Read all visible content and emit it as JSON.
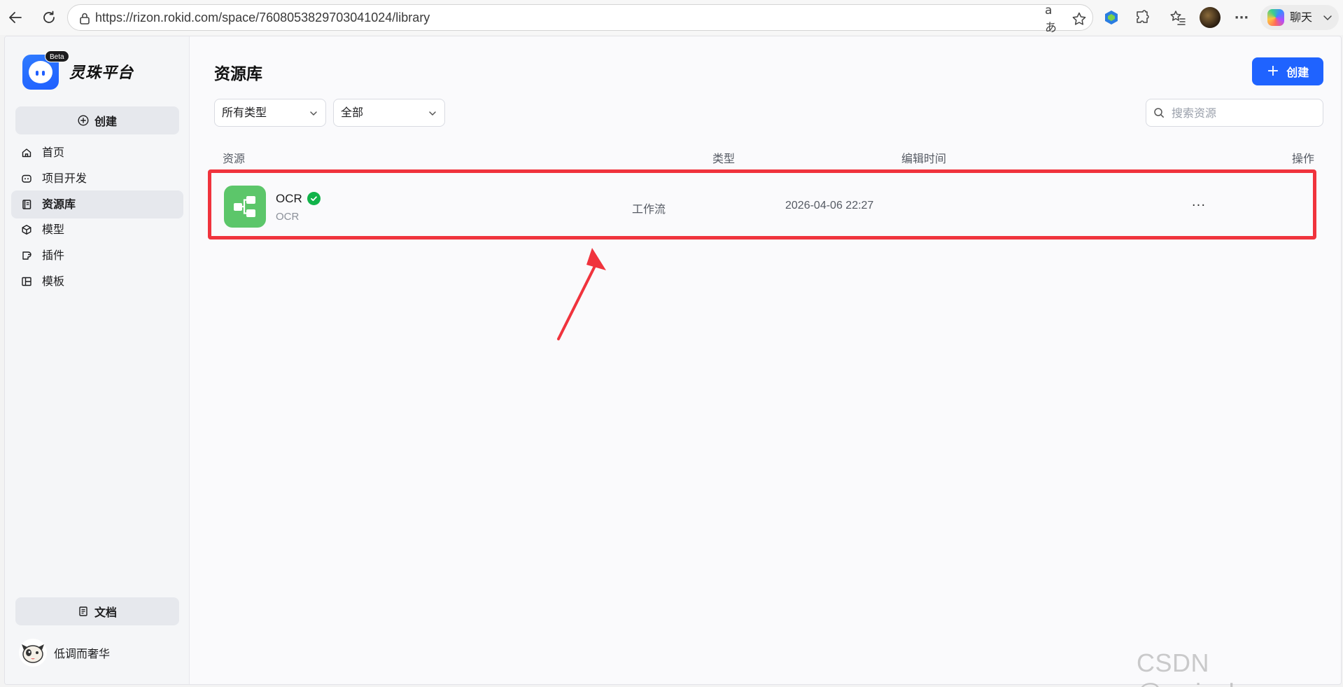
{
  "browser": {
    "url": "https://rizon.rokid.com/space/7608053829703041024/library",
    "read_aloud_icon": "aあ",
    "chat_label": "聊天"
  },
  "brand": {
    "name": "灵珠平台",
    "badge": "Beta",
    "accent": "#1f63ff"
  },
  "sidebar": {
    "create_label": "创建",
    "items": [
      {
        "label": "首页",
        "icon": "home-icon"
      },
      {
        "label": "项目开发",
        "icon": "robot-icon"
      },
      {
        "label": "资源库",
        "icon": "library-icon",
        "active": true
      },
      {
        "label": "模型",
        "icon": "cube-icon"
      },
      {
        "label": "插件",
        "icon": "plugin-icon"
      },
      {
        "label": "模板",
        "icon": "template-icon"
      }
    ],
    "docs_label": "文档",
    "user_name": "低调而奢华"
  },
  "main": {
    "title": "资源库",
    "create_label": "创建",
    "filters": {
      "type_value": "所有类型",
      "scope_value": "全部"
    },
    "search": {
      "placeholder": "搜索资源"
    },
    "table": {
      "headers": [
        "资源",
        "类型",
        "编辑时间",
        "操作"
      ],
      "rows": [
        {
          "name": "OCR",
          "subtitle": "OCR",
          "type": "工作流",
          "edited": "2026-04-06 22:27",
          "more": "···",
          "status": "published"
        }
      ]
    }
  },
  "annotation": {
    "color": "#f0333d"
  },
  "watermark": "CSDN @wei_shuo"
}
